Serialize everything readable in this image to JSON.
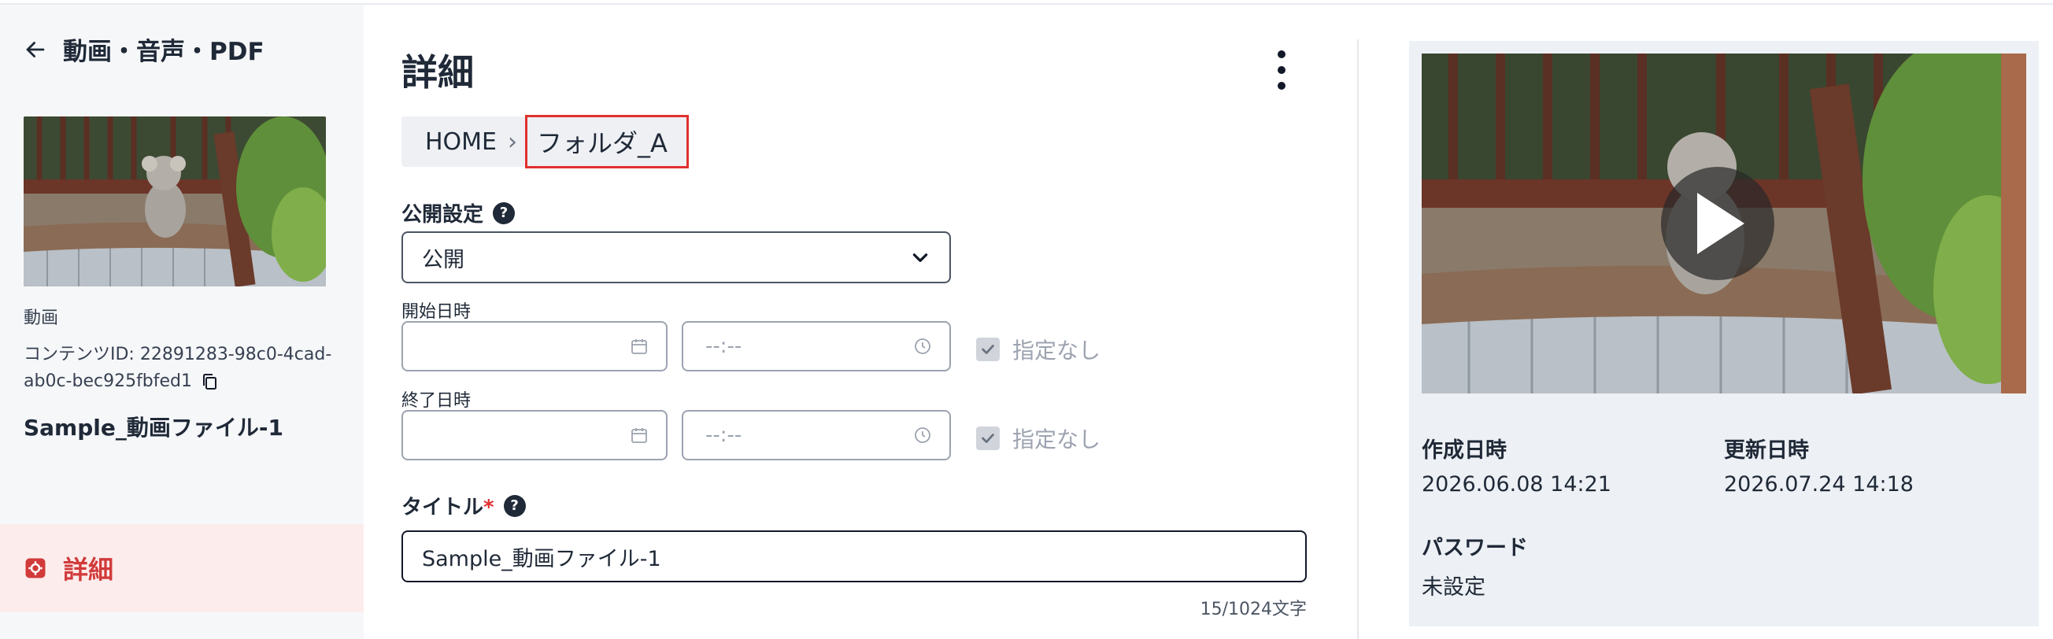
{
  "sidebar": {
    "back_title": "動画・音声・PDF",
    "type_label": "動画",
    "content_id_label": "コンテンツID: 22891283-98c0-4cad-ab0c-bec925fbfed1",
    "name": "Sample_動画ファイル-1",
    "nav_active_label": "詳細"
  },
  "main": {
    "page_title": "詳細",
    "breadcrumb": {
      "home": "HOME",
      "separator": "›",
      "folder": "フォルダ_A"
    },
    "visibility": {
      "label": "公開設定",
      "value": "公開"
    },
    "start": {
      "label": "開始日時",
      "date_value": "",
      "time_placeholder": "--:--",
      "no_setting_label": "指定なし",
      "no_setting_checked": true
    },
    "end": {
      "label": "終了日時",
      "date_value": "",
      "time_placeholder": "--:--",
      "no_setting_label": "指定なし",
      "no_setting_checked": true
    },
    "title": {
      "label": "タイトル",
      "required_mark": "*",
      "value": "Sample_動画ファイル-1",
      "counter": "15/1024文字"
    }
  },
  "panel": {
    "created_label": "作成日時",
    "created_value": "2026.06.08 14:21",
    "updated_label": "更新日時",
    "updated_value": "2026.07.24 14:18",
    "password_label": "パスワード",
    "password_value": "未設定"
  },
  "colors": {
    "accent_red": "#d23a3a",
    "highlight_border": "#e0312f",
    "active_nav_bg": "#fdecec"
  },
  "icons": [
    "arrow-left-icon",
    "copy-icon",
    "settings-icon",
    "help-icon",
    "chevron-down-icon",
    "calendar-icon",
    "clock-icon",
    "check-icon",
    "more-vertical-icon",
    "play-icon"
  ]
}
